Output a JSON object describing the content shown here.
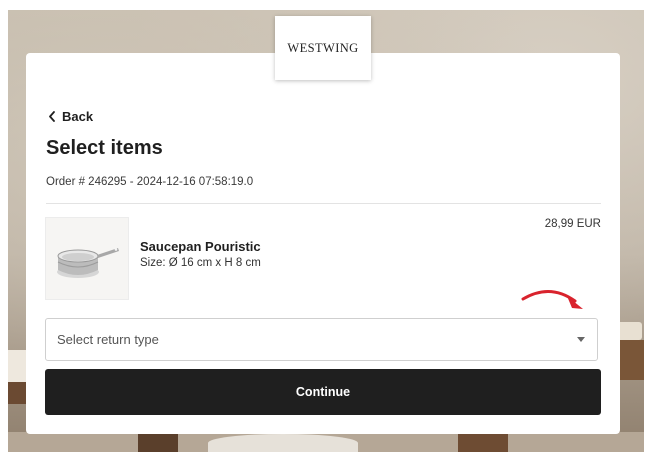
{
  "brand": {
    "logo_text": "WESTWING"
  },
  "nav": {
    "back_label": "Back",
    "back_icon": "chevron-left-icon"
  },
  "page": {
    "title": "Select items",
    "order_info": "Order # 246295 - 2024-12-16 07:58:19.0"
  },
  "item": {
    "name": "Saucepan Pouristic",
    "size": "Size: Ø 16 cm x H 8 cm",
    "price": "28,99 EUR",
    "image_icon": "saucepan-image"
  },
  "return_type": {
    "placeholder": "Select return type",
    "icon": "caret-down-icon"
  },
  "actions": {
    "continue_label": "Continue"
  },
  "colors": {
    "primary_button": "#1f1f1f",
    "annotation_arrow": "#d9232d",
    "card_background": "#ffffff"
  }
}
